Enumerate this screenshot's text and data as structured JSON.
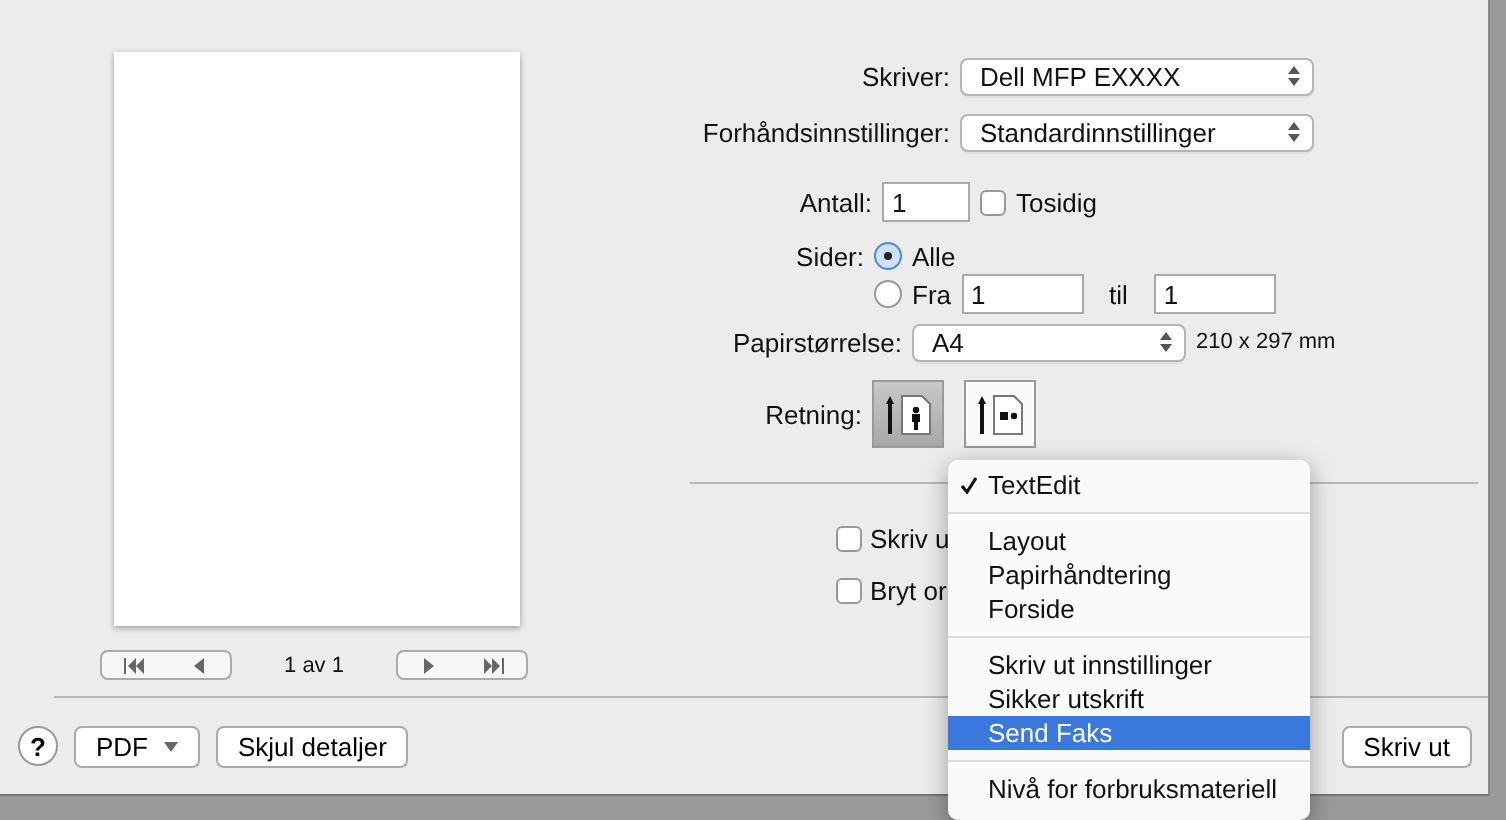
{
  "preview": {
    "page_counter": "1 av 1"
  },
  "printer": {
    "label": "Skriver:",
    "value": "Dell MFP EXXXX"
  },
  "presets": {
    "label": "Forhåndsinnstillinger:",
    "value": "Standardinnstillinger"
  },
  "copies": {
    "label": "Antall:",
    "value": "1",
    "two_sided": {
      "label": "Tosidig",
      "checked": false
    }
  },
  "pages": {
    "label": "Sider:",
    "options": [
      {
        "label": "Alle",
        "selected": true
      },
      {
        "label": "Fra",
        "selected": false
      }
    ],
    "from": "1",
    "to_label": "til",
    "to": "1"
  },
  "paper_size": {
    "label": "Papirstørrelse:",
    "value": "A4",
    "dimensions": "210 x 297 mm"
  },
  "orientation": {
    "label": "Retning:",
    "options": [
      {
        "kind": "portrait",
        "selected": true
      },
      {
        "kind": "landscape",
        "selected": false
      }
    ]
  },
  "options": [
    {
      "label": "Skriv u",
      "checked": false
    },
    {
      "label": "Bryt or",
      "checked": false
    }
  ],
  "menu": {
    "groups": [
      [
        {
          "label": "TextEdit",
          "checked": true,
          "selected": false
        }
      ],
      [
        {
          "label": "Layout",
          "checked": false,
          "selected": false
        },
        {
          "label": "Papirhåndtering",
          "checked": false,
          "selected": false
        },
        {
          "label": "Forside",
          "checked": false,
          "selected": false
        }
      ],
      [
        {
          "label": "Skriv ut innstillinger",
          "checked": false,
          "selected": false
        },
        {
          "label": "Sikker utskrift",
          "checked": false,
          "selected": false
        },
        {
          "label": "Send Faks",
          "checked": false,
          "selected": true
        }
      ],
      [
        {
          "label": "Nivå for forbruksmateriell",
          "checked": false,
          "selected": false
        }
      ]
    ]
  },
  "footer": {
    "help": "?",
    "pdf": "PDF",
    "toggle_details": "Skjul detaljer",
    "print": "Skriv ut"
  }
}
